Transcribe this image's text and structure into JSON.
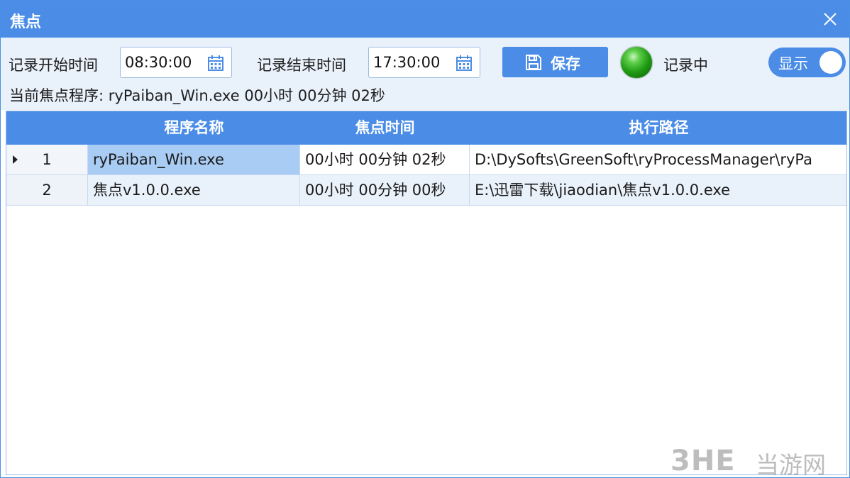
{
  "window": {
    "title": "焦点"
  },
  "toolbar": {
    "start_label": "记录开始时间",
    "start_value": "08:30:00",
    "end_label": "记录结束时间",
    "end_value": "17:30:00",
    "save_label": "保存",
    "status_text": "记录中",
    "status_color": "#1e9a12",
    "toggle_label": "显示",
    "toggle_on": true
  },
  "current": {
    "label": "当前焦点程序:",
    "program": "ryPaiban_Win.exe",
    "duration": "00小时 00分钟 02秒"
  },
  "table": {
    "columns": [
      "程序名称",
      "焦点时间",
      "执行路径"
    ],
    "rows": [
      {
        "index": "1",
        "name": "ryPaiban_Win.exe",
        "time": "00小时 00分钟 02秒",
        "path": "D:\\DySofts\\GreenSoft\\ryProcessManager\\ryPa"
      },
      {
        "index": "2",
        "name": "焦点v1.0.0.exe",
        "time": "00小时 00分钟 00秒",
        "path": "E:\\迅雷下载\\jiaodian\\焦点v1.0.0.exe"
      }
    ]
  },
  "watermark": {
    "logo": "3HE",
    "text": "当游网"
  },
  "colors": {
    "accent": "#4a8ce6",
    "toolbar_bg": "#e9f1fb",
    "selected_cell": "#a8ccf3"
  }
}
